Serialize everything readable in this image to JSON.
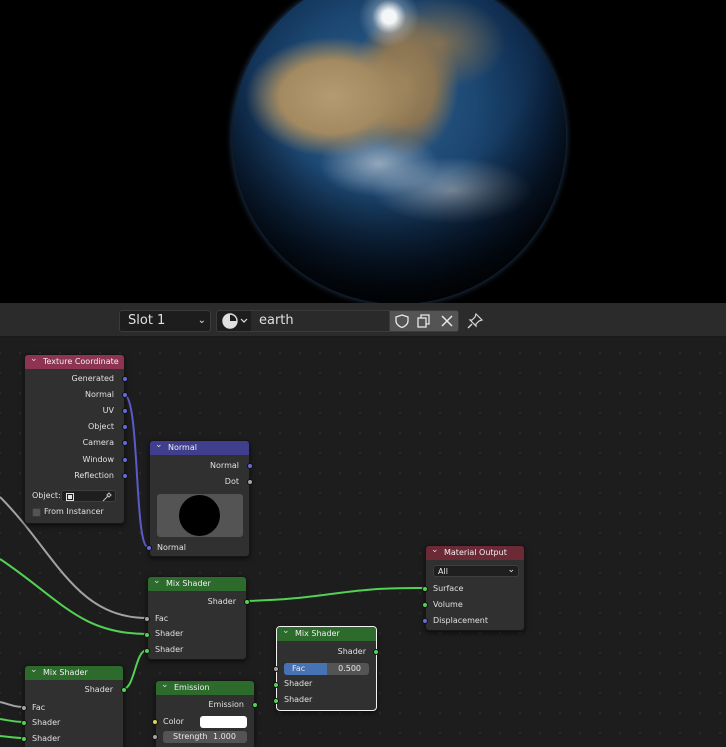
{
  "header": {
    "slot_label": "Slot 1",
    "material_name": "earth"
  },
  "colors": {
    "texcoord_header": "#8e3453",
    "vector_header": "#3f3f8e",
    "shader_header": "#2d6b2d",
    "output_header": "#6b2a36",
    "socket_vector": "#6868e0",
    "socket_shader": "#52d152",
    "socket_float": "#a3a3a3",
    "socket_color": "#d8d84a",
    "fac_slider_fill": "#4772b3"
  },
  "icons": {
    "material_type": "sphere-icon",
    "fake_user": "shield-icon",
    "duplicate": "duplicate-icon",
    "unlink": "close-icon",
    "pin": "pin-icon",
    "eyedropper": "eyedropper-icon"
  },
  "nodes": {
    "texcoord": {
      "title": "Texture Coordinate",
      "outputs": [
        "Generated",
        "Normal",
        "UV",
        "Object",
        "Camera",
        "Window",
        "Reflection"
      ],
      "object_label": "Object:",
      "from_instancer_label": "From Instancer",
      "from_instancer_checked": false
    },
    "normal": {
      "title": "Normal",
      "outputs": [
        "Normal",
        "Dot"
      ],
      "input": "Normal"
    },
    "mix1": {
      "title": "Mix Shader",
      "output": "Shader",
      "inputs": [
        "Fac",
        "Shader",
        "Shader"
      ]
    },
    "material_output": {
      "title": "Material Output",
      "target": "All",
      "inputs": [
        "Surface",
        "Volume",
        "Displacement"
      ]
    },
    "mix2": {
      "title": "Mix Shader",
      "output": "Shader",
      "fac_label": "Fac",
      "fac_value": "0.500",
      "fac_fraction": 0.5,
      "inputs": [
        "Shader",
        "Shader"
      ]
    },
    "mix3": {
      "title": "Mix Shader",
      "output": "Shader",
      "inputs": [
        "Fac",
        "Shader",
        "Shader"
      ]
    },
    "emission": {
      "title": "Emission",
      "output": "Emission",
      "color_label": "Color",
      "color_value": "#ffffff",
      "strength_label": "Strength",
      "strength_value": "1.000"
    }
  }
}
